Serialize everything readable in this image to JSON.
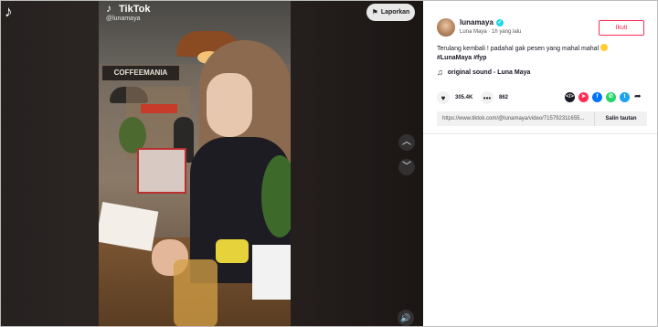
{
  "viewer": {
    "brand": "TikTok",
    "handle": "@lunamaya",
    "report_label": "Laporkan",
    "storefront_sign": "COFFEEMANIA",
    "icons": {
      "corner_logo": "tiktok-logo-icon",
      "report": "flag-icon",
      "up": "chevron-up-icon",
      "down": "chevron-down-icon",
      "volume": "volume-icon"
    }
  },
  "author": {
    "username": "lunamaya",
    "display_name": "Luna Maya",
    "posted": "1h yang lalu",
    "follow_label": "Ikuti"
  },
  "caption": {
    "text": "Terulang kembali ! padahal gak pesen yang mahal mahal",
    "hashtags": "#LunaMaya #fyp"
  },
  "music": {
    "title": "original sound - Luna Maya"
  },
  "stats": {
    "likes": "305.4K",
    "comments": "862"
  },
  "share": {
    "targets": [
      "embed",
      "friends",
      "facebook",
      "whatsapp",
      "twitter",
      "more"
    ],
    "colors": {
      "embed": "#161823",
      "friends": "#fe2c55",
      "facebook": "#0075fa",
      "whatsapp": "#25d366",
      "twitter": "#1da1f2"
    }
  },
  "link": {
    "url": "https://www.tiktok.com/@lunamaya/video/715792311655...",
    "copy_label": "Salin tautan"
  },
  "colors": {
    "accent": "#fe2c55",
    "verified": "#20d5ec"
  }
}
